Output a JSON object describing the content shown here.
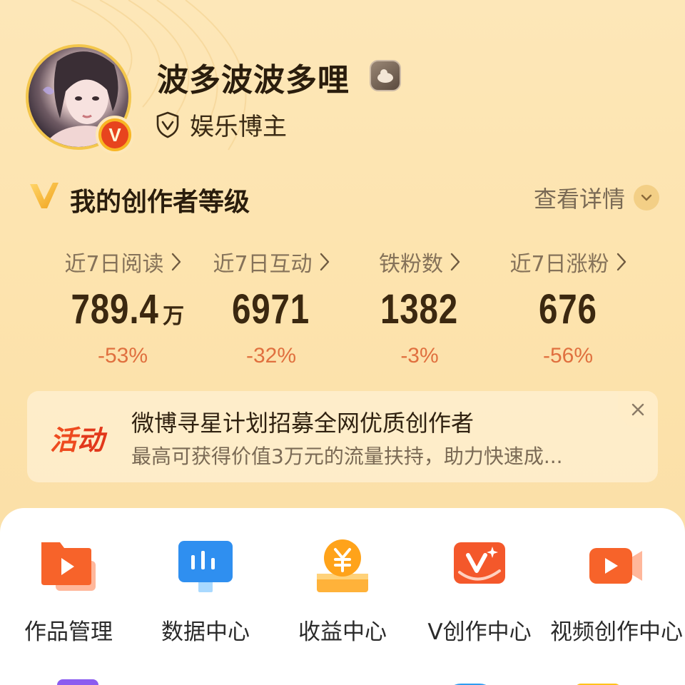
{
  "profile": {
    "username": "波多波波多哩",
    "role": "娱乐博主",
    "verified_badge": "V"
  },
  "level": {
    "title": "我的创作者等级",
    "detail_label": "查看详情"
  },
  "stats": [
    {
      "label": "近7日阅读",
      "value": "789.4",
      "unit": "万",
      "change": "-53%"
    },
    {
      "label": "近7日互动",
      "value": "6971",
      "unit": "",
      "change": "-32%"
    },
    {
      "label": "铁粉数",
      "value": "1382",
      "unit": "",
      "change": "-3%"
    },
    {
      "label": "近7日涨粉",
      "value": "676",
      "unit": "",
      "change": "-56%"
    }
  ],
  "banner": {
    "tag_1": "活",
    "tag_2": "动",
    "title": "微博寻星计划招募全网优质创作者",
    "subtitle": "最高可获得价值3万元的流量扶持，助力快速成..."
  },
  "tools": [
    {
      "label": "作品管理",
      "icon": "works-management-icon"
    },
    {
      "label": "数据中心",
      "icon": "data-center-icon"
    },
    {
      "label": "收益中心",
      "icon": "revenue-center-icon"
    },
    {
      "label": "V创作中心",
      "icon": "v-creation-center-icon"
    },
    {
      "label": "视频创作中心",
      "icon": "video-creation-center-icon"
    }
  ],
  "colors": {
    "background": "#fde5b2",
    "accent_orange": "#ee4b1f",
    "change_text": "#e0703f",
    "gold": "#f3c64c"
  }
}
